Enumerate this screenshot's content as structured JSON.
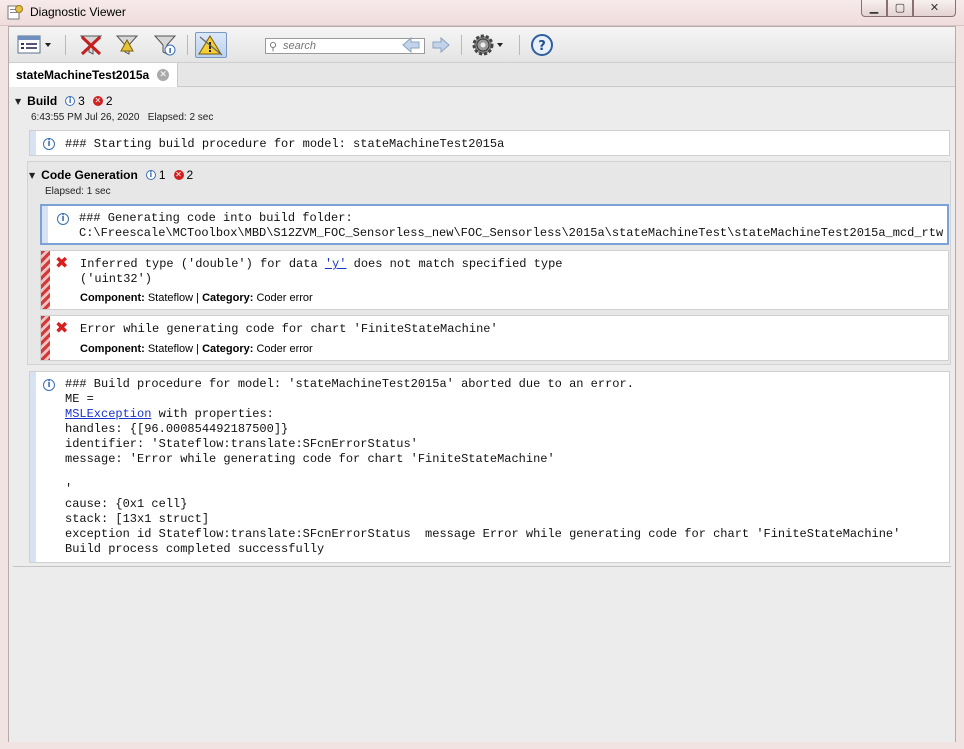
{
  "window": {
    "title": "Diagnostic Viewer"
  },
  "toolbar": {
    "search_placeholder": "search",
    "buttons": [
      "view-menu",
      "clear-all",
      "filter-errors",
      "filter-all",
      "warnings-toggle",
      "back",
      "forward",
      "settings",
      "help"
    ]
  },
  "tab": {
    "label": "stateMachineTest2015a"
  },
  "build": {
    "title": "Build",
    "info_count": "3",
    "error_count": "2",
    "timestamp": "6:43:55 PM Jul 26, 2020   Elapsed: 2 sec",
    "message1": "### Starting build procedure for model: stateMachineTest2015a"
  },
  "codegen": {
    "title": "Code Generation",
    "info_count": "1",
    "error_count": "2",
    "elapsed": "Elapsed: 1 sec",
    "info_line1": "### Generating code into build folder:",
    "info_line2": "C:\\Freescale\\MCToolbox\\MBD\\S12ZVM_FOC_Sensorless_new\\FOC_Sensorless\\2015a\\stateMachineTest\\stateMachineTest2015a_mcd_rtw",
    "err1_pre": "Inferred type ('double') for data ",
    "err1_link": "'y'",
    "err1_post": " does not match specified type",
    "err1_line2": "('uint32')",
    "err2_line1": "Error while generating code for chart 'FiniteStateMachine'",
    "component_label": "Component:",
    "component_value": "Stateflow",
    "category_label": "Category:",
    "category_value": "Coder error"
  },
  "final": {
    "line1": "### Build procedure for model: 'stateMachineTest2015a' aborted due to an error.",
    "line2": "ME =",
    "link": "MSLException",
    "line3_post": " with properties:",
    "line4": "handles: {[96.000854492187500]}",
    "line5": "identifier: 'Stateflow:translate:SFcnErrorStatus'",
    "line6": "message: 'Error while generating code for chart 'FiniteStateMachine'",
    "line7": "'",
    "line8": "cause: {0x1 cell}",
    "line9": "stack: [13x1 struct]",
    "line10": "exception id Stateflow:translate:SFcnErrorStatus  message Error while generating code for chart 'FiniteStateMachine'",
    "line11": "Build process completed successfully"
  }
}
